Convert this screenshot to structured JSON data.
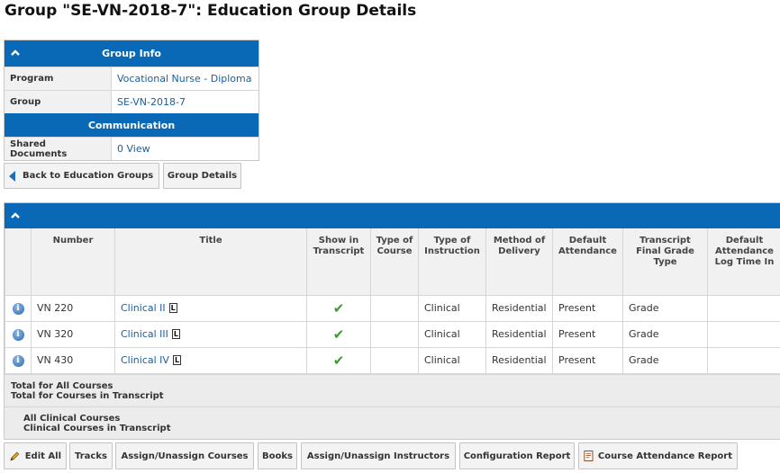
{
  "page": {
    "title": "Group \"SE-VN-2018-7\": Education Group Details"
  },
  "group_info": {
    "header": "Group Info",
    "rows": [
      {
        "label": "Program",
        "value": "Vocational Nurse - Diploma"
      },
      {
        "label": "Group",
        "value": "SE-VN-2018-7"
      }
    ],
    "communication_header": "Communication",
    "shared_docs": {
      "label": "Shared Documents",
      "count": "0",
      "link": "View"
    }
  },
  "nav": {
    "back_label": "Back to Education Groups",
    "details_label": "Group Details"
  },
  "courses": {
    "columns": [
      "Number",
      "Title",
      "Show in Transcript",
      "Type of Course",
      "Type of Instruction",
      "Method of Delivery",
      "Default Attendance",
      "Transcript Final Grade Type",
      "Default Attendance Log Time In"
    ],
    "rows": [
      {
        "info": "i",
        "number": "VN 220",
        "title": "Clinical II",
        "badge": "L",
        "show": "✔",
        "type_course": "",
        "type_instruction": "Clinical",
        "method": "Residential",
        "attendance": "Present",
        "grade_type": "Grade",
        "log_time": ""
      },
      {
        "info": "i",
        "number": "VN 320",
        "title": "Clinical III",
        "badge": "L",
        "show": "✔",
        "type_course": "",
        "type_instruction": "Clinical",
        "method": "Residential",
        "attendance": "Present",
        "grade_type": "Grade",
        "log_time": ""
      },
      {
        "info": "i",
        "number": "VN 430",
        "title": "Clinical IV",
        "badge": "L",
        "show": "✔",
        "type_course": "",
        "type_instruction": "Clinical",
        "method": "Residential",
        "attendance": "Present",
        "grade_type": "Grade",
        "log_time": ""
      }
    ],
    "totals": {
      "all": "Total for All Courses",
      "transcript": "Total for Courses in Transcript",
      "clinical_all": "All Clinical Courses",
      "clinical_transcript": "Clinical Courses in Transcript"
    }
  },
  "toolbar": {
    "edit_all": "Edit All",
    "tracks": "Tracks",
    "assign_courses": "Assign/Unassign Courses",
    "books": "Books",
    "assign_instructors": "Assign/Unassign Instructors",
    "config_report": "Configuration Report",
    "attendance_report": "Course Attendance Report"
  },
  "colors": {
    "header_blue": "#0a69b7",
    "link": "#1a5e9c",
    "check_green": "#3d9a2e"
  }
}
